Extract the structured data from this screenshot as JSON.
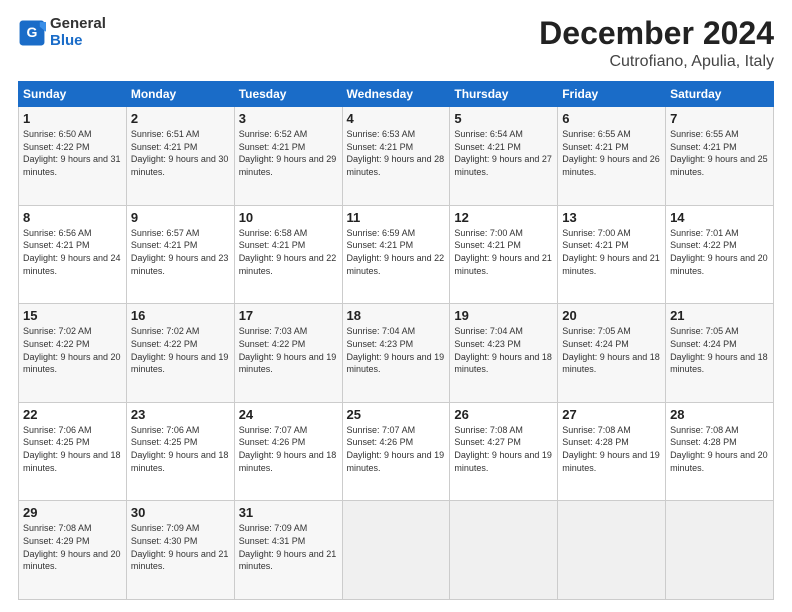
{
  "logo": {
    "text_general": "General",
    "text_blue": "Blue"
  },
  "header": {
    "month": "December 2024",
    "location": "Cutrofiano, Apulia, Italy"
  },
  "weekdays": [
    "Sunday",
    "Monday",
    "Tuesday",
    "Wednesday",
    "Thursday",
    "Friday",
    "Saturday"
  ],
  "weeks": [
    [
      {
        "day": "1",
        "sunrise": "6:50 AM",
        "sunset": "4:22 PM",
        "daylight": "9 hours and 31 minutes."
      },
      {
        "day": "2",
        "sunrise": "6:51 AM",
        "sunset": "4:21 PM",
        "daylight": "9 hours and 30 minutes."
      },
      {
        "day": "3",
        "sunrise": "6:52 AM",
        "sunset": "4:21 PM",
        "daylight": "9 hours and 29 minutes."
      },
      {
        "day": "4",
        "sunrise": "6:53 AM",
        "sunset": "4:21 PM",
        "daylight": "9 hours and 28 minutes."
      },
      {
        "day": "5",
        "sunrise": "6:54 AM",
        "sunset": "4:21 PM",
        "daylight": "9 hours and 27 minutes."
      },
      {
        "day": "6",
        "sunrise": "6:55 AM",
        "sunset": "4:21 PM",
        "daylight": "9 hours and 26 minutes."
      },
      {
        "day": "7",
        "sunrise": "6:55 AM",
        "sunset": "4:21 PM",
        "daylight": "9 hours and 25 minutes."
      }
    ],
    [
      {
        "day": "8",
        "sunrise": "6:56 AM",
        "sunset": "4:21 PM",
        "daylight": "9 hours and 24 minutes."
      },
      {
        "day": "9",
        "sunrise": "6:57 AM",
        "sunset": "4:21 PM",
        "daylight": "9 hours and 23 minutes."
      },
      {
        "day": "10",
        "sunrise": "6:58 AM",
        "sunset": "4:21 PM",
        "daylight": "9 hours and 22 minutes."
      },
      {
        "day": "11",
        "sunrise": "6:59 AM",
        "sunset": "4:21 PM",
        "daylight": "9 hours and 22 minutes."
      },
      {
        "day": "12",
        "sunrise": "7:00 AM",
        "sunset": "4:21 PM",
        "daylight": "9 hours and 21 minutes."
      },
      {
        "day": "13",
        "sunrise": "7:00 AM",
        "sunset": "4:21 PM",
        "daylight": "9 hours and 21 minutes."
      },
      {
        "day": "14",
        "sunrise": "7:01 AM",
        "sunset": "4:22 PM",
        "daylight": "9 hours and 20 minutes."
      }
    ],
    [
      {
        "day": "15",
        "sunrise": "7:02 AM",
        "sunset": "4:22 PM",
        "daylight": "9 hours and 20 minutes."
      },
      {
        "day": "16",
        "sunrise": "7:02 AM",
        "sunset": "4:22 PM",
        "daylight": "9 hours and 19 minutes."
      },
      {
        "day": "17",
        "sunrise": "7:03 AM",
        "sunset": "4:22 PM",
        "daylight": "9 hours and 19 minutes."
      },
      {
        "day": "18",
        "sunrise": "7:04 AM",
        "sunset": "4:23 PM",
        "daylight": "9 hours and 19 minutes."
      },
      {
        "day": "19",
        "sunrise": "7:04 AM",
        "sunset": "4:23 PM",
        "daylight": "9 hours and 18 minutes."
      },
      {
        "day": "20",
        "sunrise": "7:05 AM",
        "sunset": "4:24 PM",
        "daylight": "9 hours and 18 minutes."
      },
      {
        "day": "21",
        "sunrise": "7:05 AM",
        "sunset": "4:24 PM",
        "daylight": "9 hours and 18 minutes."
      }
    ],
    [
      {
        "day": "22",
        "sunrise": "7:06 AM",
        "sunset": "4:25 PM",
        "daylight": "9 hours and 18 minutes."
      },
      {
        "day": "23",
        "sunrise": "7:06 AM",
        "sunset": "4:25 PM",
        "daylight": "9 hours and 18 minutes."
      },
      {
        "day": "24",
        "sunrise": "7:07 AM",
        "sunset": "4:26 PM",
        "daylight": "9 hours and 18 minutes."
      },
      {
        "day": "25",
        "sunrise": "7:07 AM",
        "sunset": "4:26 PM",
        "daylight": "9 hours and 19 minutes."
      },
      {
        "day": "26",
        "sunrise": "7:08 AM",
        "sunset": "4:27 PM",
        "daylight": "9 hours and 19 minutes."
      },
      {
        "day": "27",
        "sunrise": "7:08 AM",
        "sunset": "4:28 PM",
        "daylight": "9 hours and 19 minutes."
      },
      {
        "day": "28",
        "sunrise": "7:08 AM",
        "sunset": "4:28 PM",
        "daylight": "9 hours and 20 minutes."
      }
    ],
    [
      {
        "day": "29",
        "sunrise": "7:08 AM",
        "sunset": "4:29 PM",
        "daylight": "9 hours and 20 minutes."
      },
      {
        "day": "30",
        "sunrise": "7:09 AM",
        "sunset": "4:30 PM",
        "daylight": "9 hours and 21 minutes."
      },
      {
        "day": "31",
        "sunrise": "7:09 AM",
        "sunset": "4:31 PM",
        "daylight": "9 hours and 21 minutes."
      },
      null,
      null,
      null,
      null
    ]
  ]
}
